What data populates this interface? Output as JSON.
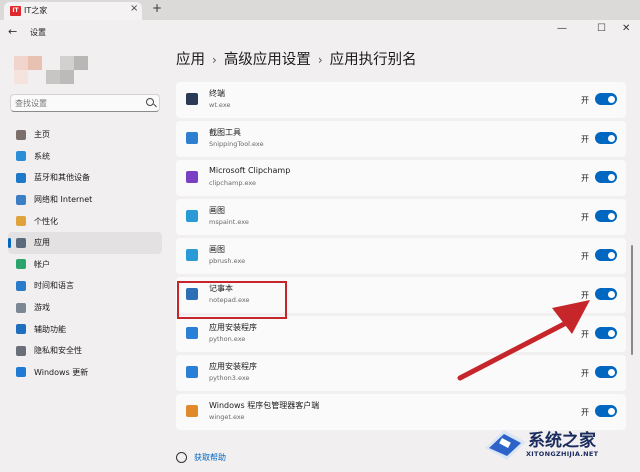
{
  "browser": {
    "tab_title": "IT之家",
    "favicon_text": "IT",
    "close_glyph": "×",
    "new_tab_glyph": "+"
  },
  "window": {
    "back_glyph": "←",
    "title": "设置",
    "minimize_glyph": "—",
    "maximize_glyph": "☐",
    "close_glyph": "✕"
  },
  "search": {
    "placeholder": "查找设置"
  },
  "sidebar": {
    "items": [
      {
        "label": "主页",
        "icon": "home-icon",
        "color": "#7b6f6b"
      },
      {
        "label": "系统",
        "icon": "monitor-icon",
        "color": "#2a8fd6"
      },
      {
        "label": "蓝牙和其他设备",
        "icon": "bluetooth-icon",
        "color": "#1f79c9"
      },
      {
        "label": "网络和 Internet",
        "icon": "wifi-icon",
        "color": "#3c7fc7"
      },
      {
        "label": "个性化",
        "icon": "brush-icon",
        "color": "#e0a23c"
      },
      {
        "label": "应用",
        "icon": "apps-icon",
        "color": "#5a6b7e",
        "active": true
      },
      {
        "label": "帐户",
        "icon": "person-icon",
        "color": "#2aa56b"
      },
      {
        "label": "时间和语言",
        "icon": "globe-clock-icon",
        "color": "#2a7bc9"
      },
      {
        "label": "游戏",
        "icon": "game-controller-icon",
        "color": "#7b8794"
      },
      {
        "label": "辅助功能",
        "icon": "accessibility-icon",
        "color": "#1f6fbf"
      },
      {
        "label": "隐私和安全性",
        "icon": "shield-icon",
        "color": "#6b6f78"
      },
      {
        "label": "Windows 更新",
        "icon": "update-icon",
        "color": "#1f7bd6"
      }
    ]
  },
  "breadcrumb": [
    "应用",
    "高级应用设置",
    "应用执行别名"
  ],
  "breadcrumb_sep": "›",
  "aliases": [
    {
      "name": "终端",
      "exe": "wt.exe",
      "state": "开",
      "on": true,
      "icon": "terminal-icon",
      "color": "#2b3a55"
    },
    {
      "name": "截图工具",
      "exe": "SnippingTool.exe",
      "state": "开",
      "on": true,
      "icon": "snipping-tool-icon",
      "color": "#2f7fd1"
    },
    {
      "name": "Microsoft Clipchamp",
      "exe": "clipchamp.exe",
      "state": "开",
      "on": true,
      "icon": "clipchamp-icon",
      "color": "#7b3fc4"
    },
    {
      "name": "画图",
      "exe": "mspaint.exe",
      "state": "开",
      "on": true,
      "icon": "paint-icon",
      "color": "#2a9ad6"
    },
    {
      "name": "画图",
      "exe": "pbrush.exe",
      "state": "开",
      "on": true,
      "icon": "paint-icon",
      "color": "#2a9ad6"
    },
    {
      "name": "记事本",
      "exe": "notepad.exe",
      "state": "开",
      "on": true,
      "icon": "notepad-icon",
      "color": "#2d6fb5"
    },
    {
      "name": "应用安装程序",
      "exe": "python.exe",
      "state": "开",
      "on": true,
      "icon": "app-installer-icon",
      "color": "#2a7fd6"
    },
    {
      "name": "应用安装程序",
      "exe": "python3.exe",
      "state": "开",
      "on": true,
      "icon": "app-installer-icon",
      "color": "#2a7fd6"
    },
    {
      "name": "Windows 程序包管理器客户端",
      "exe": "winget.exe",
      "state": "开",
      "on": true,
      "icon": "package-manager-icon",
      "color": "#e08a2a"
    }
  ],
  "help": {
    "label": "获取帮助"
  },
  "watermark": {
    "title": "系统之家",
    "subtitle": "XITONGZHIJIA.NET"
  },
  "colors": {
    "accent": "#0067c0",
    "highlight": "#c6262a"
  }
}
